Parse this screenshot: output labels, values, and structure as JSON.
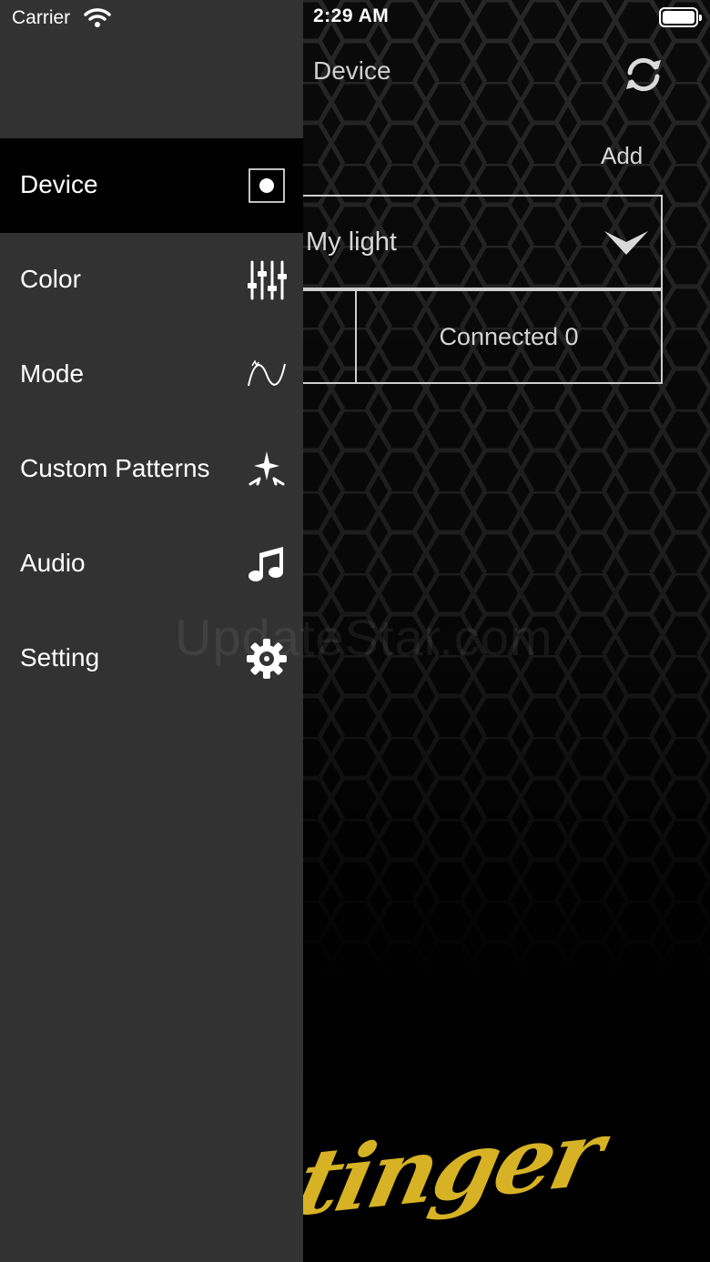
{
  "status_bar": {
    "carrier": "Carrier",
    "time": "2:29 AM"
  },
  "header": {
    "title": "Device",
    "refresh_icon": "refresh-icon",
    "add_label": "Add"
  },
  "device_panel": {
    "selected_device": "My light",
    "connected_label": "Connected 0"
  },
  "watermark": "UpdateStar.com",
  "brand_logo_text": "Stinger",
  "drawer": {
    "items": [
      {
        "label": "Device",
        "icon": "device-icon",
        "active": true
      },
      {
        "label": "Color",
        "icon": "sliders-icon",
        "active": false
      },
      {
        "label": "Mode",
        "icon": "wave-icon",
        "active": false
      },
      {
        "label": "Custom Patterns",
        "icon": "sparkle-icon",
        "active": false
      },
      {
        "label": "Audio",
        "icon": "music-note-icon",
        "active": false
      },
      {
        "label": "Setting",
        "icon": "gear-icon",
        "active": false
      }
    ]
  },
  "colors": {
    "drawer_bg": "#323232",
    "active_item_bg": "#000000",
    "brand_yellow": "#d6b224"
  }
}
